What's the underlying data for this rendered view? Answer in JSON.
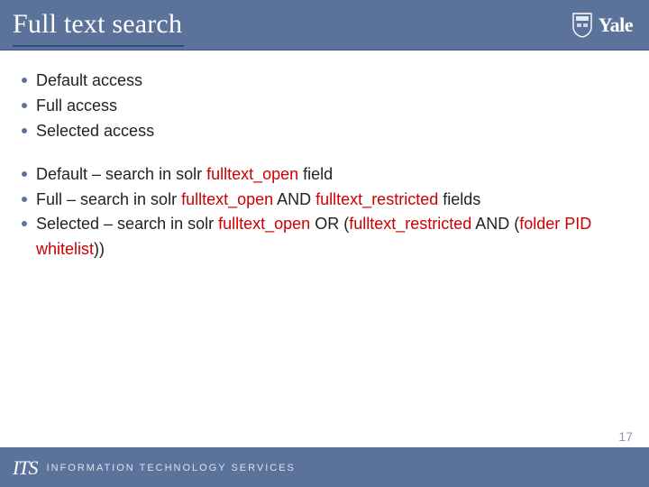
{
  "header": {
    "title": "Full text search",
    "brand": "Yale"
  },
  "list1": {
    "i0": "Default access",
    "i1": "Full access",
    "i2": "Selected access"
  },
  "list2": {
    "i0a": "Default – search in solr ",
    "i0b": "fulltext_open",
    "i0c": " field",
    "i1a": "Full – search in solr ",
    "i1b": "fulltext_open",
    "i1c": " AND ",
    "i1d": "fulltext_restricted",
    "i1e": " fields",
    "i2a": "Selected – search in solr ",
    "i2b": "fulltext_open",
    "i2c": " OR (",
    "i2d": "fulltext_restricted",
    "i2e": " AND (",
    "i2f": "folder PID whitelist",
    "i2g": "))"
  },
  "footer": {
    "its_mark": "ITS",
    "its_text": "INFORMATION TECHNOLOGY SERVICES"
  },
  "page_number": "17"
}
